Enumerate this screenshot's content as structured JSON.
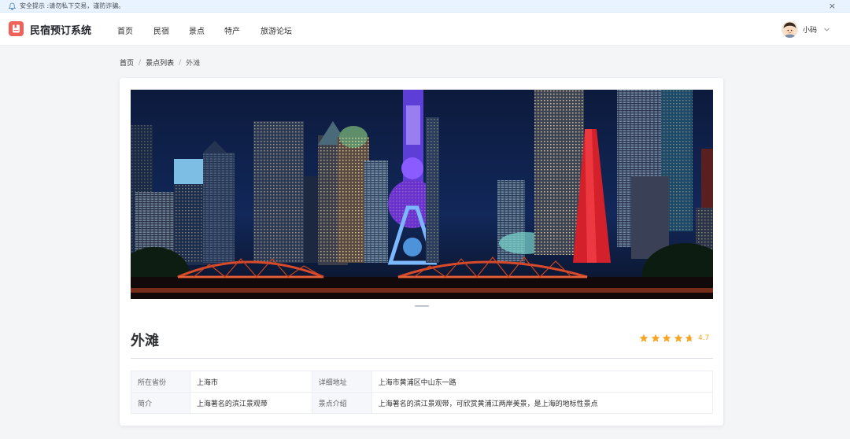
{
  "notice": {
    "text": "安全提示 :请勿私下交易，谨防诈骗。",
    "close": "×"
  },
  "header": {
    "brand": "民宿预订系统",
    "nav": [
      "首页",
      "民宿",
      "景点",
      "特产",
      "旅游论坛"
    ],
    "user": {
      "name": "小码"
    }
  },
  "breadcrumb": {
    "items": [
      "首页",
      "景点列表",
      "外滩"
    ],
    "separator": "/"
  },
  "attraction": {
    "name": "外滩",
    "rating": {
      "value": 4.7,
      "label": "4.7",
      "max": 5
    },
    "info": [
      {
        "label": "所在省份",
        "value": "上海市",
        "label2": "详细地址",
        "value2": "上海市黄浦区中山东一路"
      },
      {
        "label": "简介",
        "value": "上海著名的滨江景观带",
        "label2": "景点介绍",
        "value2": "上海著名的滨江景观带，可欣赏黄浦江两岸美景，是上海的地标性景点"
      }
    ]
  },
  "colors": {
    "accent": "#f0615a",
    "star": "#f5a623",
    "notice_bg": "#e8f3ff"
  },
  "icons": {
    "notice": "bell-icon",
    "close": "close-icon",
    "logo": "bookmark-logo-icon",
    "user_menu": "chevron-down-icon",
    "rating": "star-icon"
  }
}
